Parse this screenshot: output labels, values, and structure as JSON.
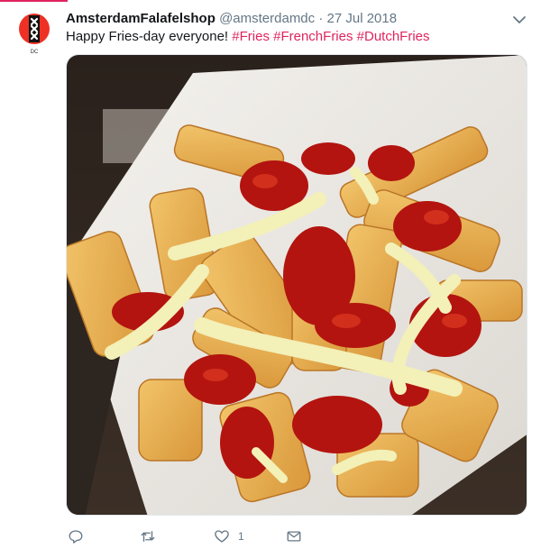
{
  "tweet": {
    "display_name": "AmsterdamFalafelshop",
    "handle": "@amsterdamdc",
    "separator": "·",
    "date": "27 Jul 2018",
    "text": "Happy Fries-day everyone!",
    "hashtags": [
      "#Fries",
      "#FrenchFries",
      "#DutchFries"
    ],
    "avatar_caption": "DC",
    "media_alt": "French fries in a paper cone topped with ketchup and mayonnaise",
    "actions": {
      "reply_icon": "reply-icon",
      "retweet_icon": "retweet-icon",
      "like_icon": "heart-icon",
      "like_count": "1",
      "dm_icon": "envelope-icon"
    }
  },
  "colors": {
    "hashtag": "#e0245e",
    "text": "#14171a",
    "muted": "#657786"
  }
}
